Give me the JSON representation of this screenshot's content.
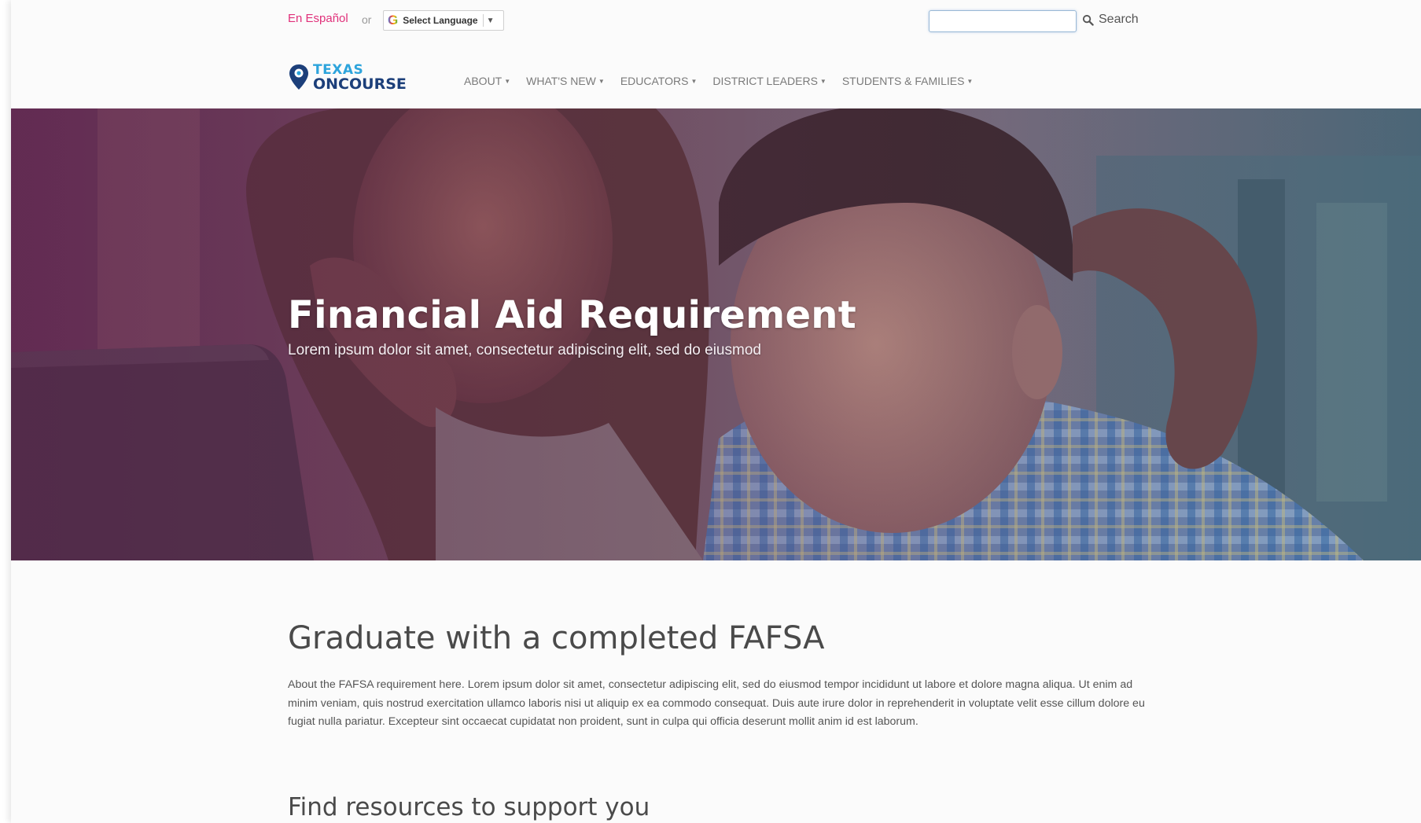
{
  "utility_bar": {
    "espanol_label": "En Español",
    "or_label": "or",
    "language_select_label": "Select Language",
    "search_label": "Search",
    "search_value": ""
  },
  "logo": {
    "line1": "TEXAS",
    "line2": "ONCOURSE"
  },
  "nav": {
    "items": [
      {
        "label": "ABOUT"
      },
      {
        "label": "WHAT'S NEW"
      },
      {
        "label": "EDUCATORS"
      },
      {
        "label": "DISTRICT LEADERS"
      },
      {
        "label": "STUDENTS & FAMILIES"
      }
    ]
  },
  "hero": {
    "title": "Financial Aid Requirement",
    "subtitle": "Lorem ipsum dolor sit amet, consectetur adipiscing elit, sed do eiusmod"
  },
  "content": {
    "heading": "Graduate with a completed FAFSA",
    "body": "About the FAFSA requirement here. Lorem ipsum dolor sit amet, consectetur adipiscing elit, sed do eiusmod tempor incididunt ut labore et dolore magna aliqua. Ut enim ad minim veniam, quis nostrud exercitation ullamco laboris nisi ut aliquip ex ea commodo consequat. Duis aute irure dolor in reprehenderit in voluptate velit esse cillum dolore eu fugiat nulla pariatur. Excepteur sint occaecat cupidatat non proident, sunt in culpa qui officia deserunt mollit anim id est laborum.",
    "subheading": "Find resources to support you"
  },
  "colors": {
    "espanol_link": "#e0307a",
    "logo_primary": "#1c3f7a",
    "logo_secondary": "#2da4dc",
    "hero_overlay": "#5a2a55"
  },
  "icons": {
    "search": "search-icon",
    "logo_pin": "map-pin-icon",
    "google": "google-icon",
    "dropdown": "caret-down-icon"
  }
}
